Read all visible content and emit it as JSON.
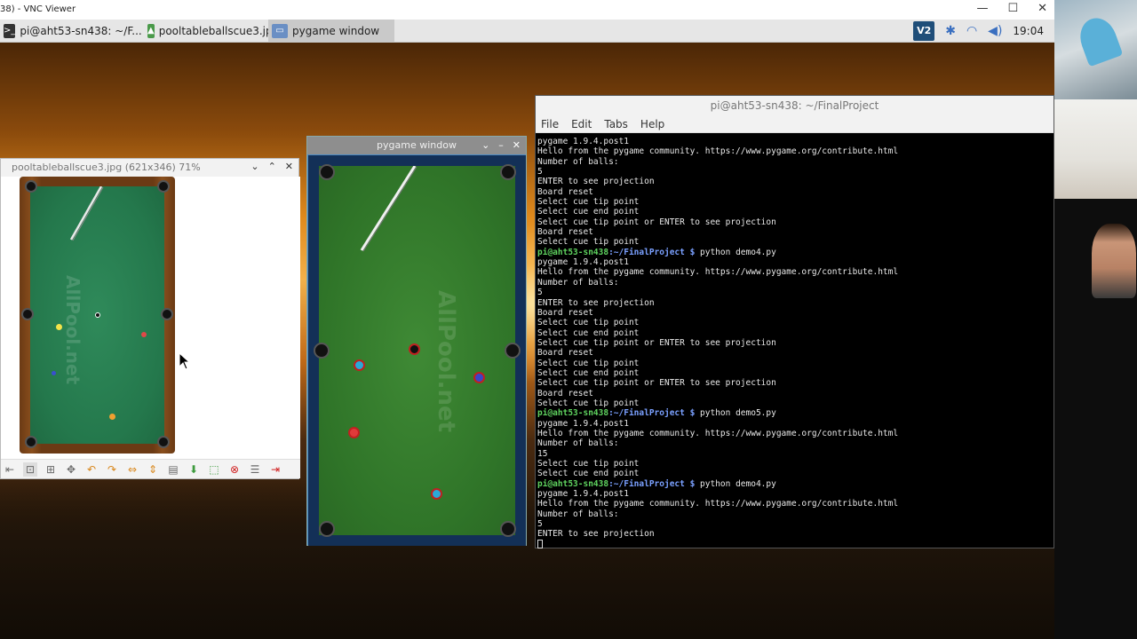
{
  "vnc": {
    "title": "38) - VNC Viewer",
    "min": "—",
    "max": "☐",
    "close": "✕"
  },
  "taskbar": {
    "items": [
      {
        "label": "pi@aht53-sn438: ~/F..."
      },
      {
        "label": "pooltableballscue3.jp..."
      },
      {
        "label": "pygame window"
      }
    ],
    "vnc_badge": "V2",
    "clock": "19:04"
  },
  "viewer": {
    "title": "pooltableballscue3.jpg (621x346) 71%"
  },
  "pygame": {
    "title": "pygame window"
  },
  "terminal": {
    "title": "pi@aht53-sn438: ~/FinalProject",
    "menu": [
      "File",
      "Edit",
      "Tabs",
      "Help"
    ],
    "lines": [
      {
        "text": "pygame 1.9.4.post1"
      },
      {
        "text": "Hello from the pygame community. https://www.pygame.org/contribute.html"
      },
      {
        "text": "Number of balls:"
      },
      {
        "text": "5"
      },
      {
        "text": "ENTER to see projection"
      },
      {
        "text": "Board reset"
      },
      {
        "text": "Select cue tip point"
      },
      {
        "text": "Select cue end point"
      },
      {
        "text": "Select cue tip point or ENTER to see projection"
      },
      {
        "text": "Board reset"
      },
      {
        "text": "Select cue tip point"
      },
      {
        "prompt": "pi@aht53-sn438",
        "path": ":~/FinalProject $",
        "cmd": " python demo4.py"
      },
      {
        "text": "pygame 1.9.4.post1"
      },
      {
        "text": "Hello from the pygame community. https://www.pygame.org/contribute.html"
      },
      {
        "text": "Number of balls:"
      },
      {
        "text": "5"
      },
      {
        "text": "ENTER to see projection"
      },
      {
        "text": "Board reset"
      },
      {
        "text": "Select cue tip point"
      },
      {
        "text": "Select cue end point"
      },
      {
        "text": "Select cue tip point or ENTER to see projection"
      },
      {
        "text": "Board reset"
      },
      {
        "text": "Select cue tip point"
      },
      {
        "text": "Select cue end point"
      },
      {
        "text": "Select cue tip point or ENTER to see projection"
      },
      {
        "text": "Board reset"
      },
      {
        "text": "Select cue tip point"
      },
      {
        "prompt": "pi@aht53-sn438",
        "path": ":~/FinalProject $",
        "cmd": " python demo5.py"
      },
      {
        "text": "pygame 1.9.4.post1"
      },
      {
        "text": "Hello from the pygame community. https://www.pygame.org/contribute.html"
      },
      {
        "text": "Number of balls:"
      },
      {
        "text": "15"
      },
      {
        "text": "Select cue tip point"
      },
      {
        "text": "Select cue end point"
      },
      {
        "prompt": "pi@aht53-sn438",
        "path": ":~/FinalProject $",
        "cmd": " python demo4.py"
      },
      {
        "text": "pygame 1.9.4.post1"
      },
      {
        "text": "Hello from the pygame community. https://www.pygame.org/contribute.html"
      },
      {
        "text": "Number of balls:"
      },
      {
        "text": "5"
      },
      {
        "text": "ENTER to see projection"
      }
    ]
  },
  "watermark": {
    "text": "AllPool.net"
  }
}
